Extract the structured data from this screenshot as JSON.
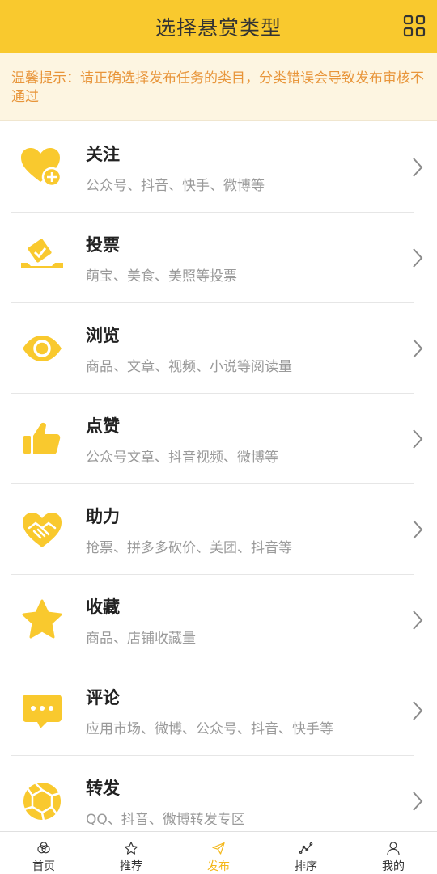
{
  "header": {
    "title": "选择悬赏类型",
    "menu_icon": "grid-icon"
  },
  "notice": {
    "text": "温馨提示：请正确选择发布任务的类目，分类错误会导致发布审核不通过"
  },
  "categories": [
    {
      "title": "关注",
      "subtitle": "公众号、抖音、快手、微博等",
      "icon": "heart-plus-icon"
    },
    {
      "title": "投票",
      "subtitle": "萌宝、美食、美照等投票",
      "icon": "ballot-box-icon"
    },
    {
      "title": "浏览",
      "subtitle": "商品、文章、视频、小说等阅读量",
      "icon": "eye-icon"
    },
    {
      "title": "点赞",
      "subtitle": "公众号文章、抖音视频、微博等",
      "icon": "thumbs-up-icon"
    },
    {
      "title": "助力",
      "subtitle": "抢票、拼多多砍价、美团、抖音等",
      "icon": "heart-handshake-icon"
    },
    {
      "title": "收藏",
      "subtitle": "商品、店铺收藏量",
      "icon": "star-icon"
    },
    {
      "title": "评论",
      "subtitle": "应用市场、微博、公众号、抖音、快手等",
      "icon": "comment-bubble-icon"
    },
    {
      "title": "转发",
      "subtitle": "QQ、抖音、微博转发专区",
      "icon": "aperture-icon"
    }
  ],
  "tabbar": [
    {
      "label": "首页",
      "icon": "home-icon",
      "active": false
    },
    {
      "label": "推荐",
      "icon": "star-outline-icon",
      "active": false
    },
    {
      "label": "发布",
      "icon": "send-icon",
      "active": true
    },
    {
      "label": "排序",
      "icon": "chart-line-icon",
      "active": false
    },
    {
      "label": "我的",
      "icon": "user-icon",
      "active": false
    }
  ],
  "colors": {
    "brand": "#f9c92e",
    "notice_text": "#e8953a",
    "icon": "#f9c92e",
    "active_tab": "#f4b719"
  }
}
